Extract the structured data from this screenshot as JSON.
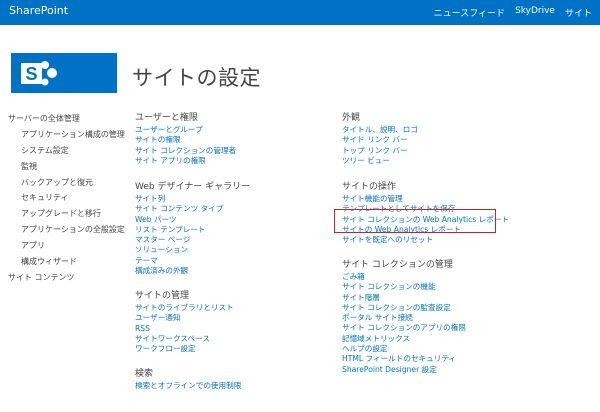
{
  "topbar": {
    "brand": "SharePoint",
    "links": [
      "ニュースフィード",
      "SkyDrive",
      "サイト"
    ]
  },
  "page_title": "サイトの設定",
  "left_nav": [
    {
      "label": "サーバーの全体管理",
      "level": 0
    },
    {
      "label": "アプリケーション構成の管理",
      "level": 1
    },
    {
      "label": "システム設定",
      "level": 1
    },
    {
      "label": "監視",
      "level": 1
    },
    {
      "label": "バックアップと復元",
      "level": 1
    },
    {
      "label": "セキュリティ",
      "level": 1
    },
    {
      "label": "アップグレードと移行",
      "level": 1
    },
    {
      "label": "アプリケーションの全般設定",
      "level": 1
    },
    {
      "label": "アプリ",
      "level": 1
    },
    {
      "label": "構成ウィザード",
      "level": 1
    },
    {
      "label": "サイト コンテンツ",
      "level": 0
    }
  ],
  "sections_col1": [
    {
      "heading": "ユーザーと権限",
      "links": [
        "ユーザーとグループ",
        "サイトの権限",
        "サイト コレクションの管理者",
        "サイト アプリの権限"
      ]
    },
    {
      "heading": "Web デザイナー ギャラリー",
      "links": [
        "サイト列",
        "サイト コンテンツ タイプ",
        "Web パーツ",
        "リスト テンプレート",
        "マスター ページ",
        "ソリューション",
        "テーマ",
        "構成済みの外観"
      ]
    },
    {
      "heading": "サイトの管理",
      "links": [
        "サイトのライブラリとリスト",
        "ユーザー通知",
        "RSS",
        "サイトワークスペース",
        "ワークフロー設定"
      ]
    },
    {
      "heading": "検索",
      "links": [
        "検索とオフラインでの使用制限"
      ]
    }
  ],
  "sections_col2": [
    {
      "heading": "外観",
      "links": [
        "タイトル、説明、ロゴ",
        "サイド リンク バー",
        "トップ リンク バー",
        "ツリー ビュー"
      ]
    },
    {
      "heading": "サイトの操作",
      "links": [
        "サイト機能の管理",
        "テンプレートとしてサイトを保存",
        "サイト コレクションの Web Analytics レポート",
        "サイトの Web Analytics レポート",
        "サイトを既定へのリセット"
      ]
    },
    {
      "heading": "サイト コレクションの管理",
      "links": [
        "ごみ箱",
        "サイト コレクションの機能",
        "サイト階層",
        "サイト コレクションの監査設定",
        "ポータル サイト接続",
        "サイト コレクションのアプリの権限",
        "記憶域メトリックス",
        "ヘルプの設定",
        "HTML フィールドのセキュリティ",
        "SharePoint Designer 設定"
      ]
    }
  ]
}
